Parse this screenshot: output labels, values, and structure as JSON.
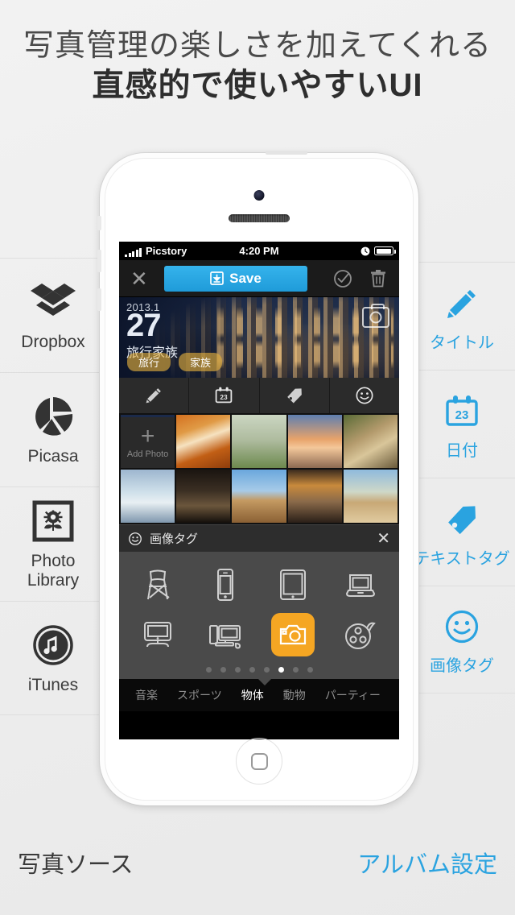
{
  "headline": {
    "line1": "写真管理の楽しさを加えてくれる",
    "line2": "直感的で使いやすいUI"
  },
  "colors": {
    "accent_blue": "#2aa3e0",
    "save_blue": "#29a7e4",
    "selected_orange": "#f5a623",
    "tag_gold": "#e6b23e",
    "page_bg": "#eeeeee",
    "sidebar_text": "#3a3a3a"
  },
  "sidebar_left": {
    "items": [
      {
        "label": "Dropbox",
        "icon": "dropbox-icon"
      },
      {
        "label": "Picasa",
        "icon": "picasa-icon"
      },
      {
        "label": "Photo Library",
        "label_line1": "Photo",
        "label_line2": "Library",
        "icon": "photo-library-icon"
      },
      {
        "label": "iTunes",
        "icon": "itunes-icon"
      }
    ]
  },
  "sidebar_right": {
    "items": [
      {
        "label": "タイトル",
        "icon": "pencil-icon"
      },
      {
        "label": "日付",
        "icon": "calendar-icon",
        "badge": "23"
      },
      {
        "label": "テキストタグ",
        "icon": "tag-icon"
      },
      {
        "label": "画像タグ",
        "icon": "smiley-icon"
      }
    ]
  },
  "phone": {
    "statusbar": {
      "carrier": "Picstory",
      "time": "4:20 PM",
      "clock_icon": "alarm-clock-icon",
      "battery_icon": "battery-icon"
    },
    "toolbar": {
      "close_label": "✕",
      "save_label": "Save",
      "save_icon": "download-icon",
      "select_all_icon": "check-circle-icon",
      "delete_icon": "trash-icon"
    },
    "hero": {
      "year": "2013.1",
      "day": "27",
      "title": "旅行家族",
      "tags": [
        "旅行",
        "家族"
      ],
      "camera_icon": "camera-icon"
    },
    "edit_row": [
      {
        "icon": "pencil-icon",
        "name": "title"
      },
      {
        "icon": "calendar-icon",
        "name": "date",
        "badge": "23"
      },
      {
        "icon": "tag-icon",
        "name": "text-tag"
      },
      {
        "icon": "smiley-icon",
        "name": "image-tag"
      }
    ],
    "thumbnails": {
      "add_photo_label": "Add Photo",
      "add_photo_plus": "+",
      "row1": [
        "canyon",
        "bird",
        "sunset-pier",
        "leopard"
      ],
      "row2": [
        "glacier",
        "night-street",
        "desert-dune",
        "beach-silhouette",
        "pyramids"
      ]
    },
    "tag_panel": {
      "icon": "smiley-icon",
      "title": "画像タグ",
      "close_label": "✕",
      "grid": [
        [
          "chair-icon",
          "smartphone-icon",
          "tablet-icon",
          "laptop-icon"
        ],
        [
          "monitor-icon",
          "desktop-pc-icon",
          "camera-icon",
          "film-reel-icon"
        ]
      ],
      "selected_icon": "camera-icon",
      "page_count": 8,
      "page_active_index": 5
    },
    "tabs": [
      {
        "label": "音楽",
        "active": false
      },
      {
        "label": "スポーツ",
        "active": false
      },
      {
        "label": "物体",
        "active": true
      },
      {
        "label": "動物",
        "active": false
      },
      {
        "label": "パーティー",
        "active": false
      }
    ]
  },
  "footer": {
    "left_label": "写真ソース",
    "right_label": "アルバム設定"
  }
}
